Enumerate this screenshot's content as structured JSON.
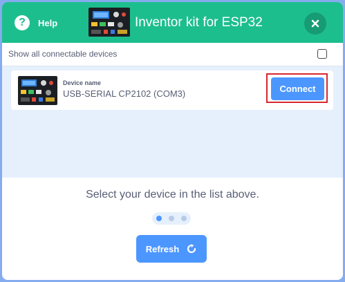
{
  "header": {
    "help_label": "Help",
    "help_icon_glyph": "?",
    "title": "Inventor kit for ESP32",
    "close_icon": "close-icon",
    "accent_color": "#1dbe8e"
  },
  "options": {
    "show_all_label": "Show all connectable devices",
    "show_all_checked": false
  },
  "devices": [
    {
      "name_label": "Device name",
      "name": "USB-SERIAL CP2102 (COM3)",
      "connect_label": "Connect",
      "icon": "esp32-board-icon"
    }
  ],
  "footer": {
    "instruction": "Select your device in the list above.",
    "step_count": 3,
    "current_step": 1,
    "refresh_label": "Refresh",
    "refresh_icon": "refresh-icon"
  },
  "colors": {
    "button_blue": "#4c97ff",
    "list_background": "#e6f0fd",
    "highlight_outline": "#d9262f",
    "text": "#575e75"
  }
}
